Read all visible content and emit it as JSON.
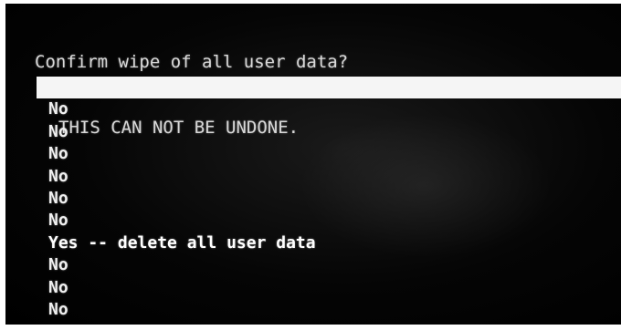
{
  "prompt": {
    "title": "Confirm wipe of all user data?",
    "warning": "THIS CAN NOT BE UNDONE."
  },
  "menu": {
    "selected_index": 0,
    "items": [
      {
        "label": ""
      },
      {
        "label": "No"
      },
      {
        "label": "No"
      },
      {
        "label": "No"
      },
      {
        "label": "No"
      },
      {
        "label": "No"
      },
      {
        "label": "No"
      },
      {
        "label": "Yes -- delete all user data"
      },
      {
        "label": "No"
      },
      {
        "label": "No"
      },
      {
        "label": "No"
      }
    ]
  },
  "colors": {
    "background": "#000000",
    "text": "#f0f0f0",
    "highlight": "#f5f5f5"
  }
}
